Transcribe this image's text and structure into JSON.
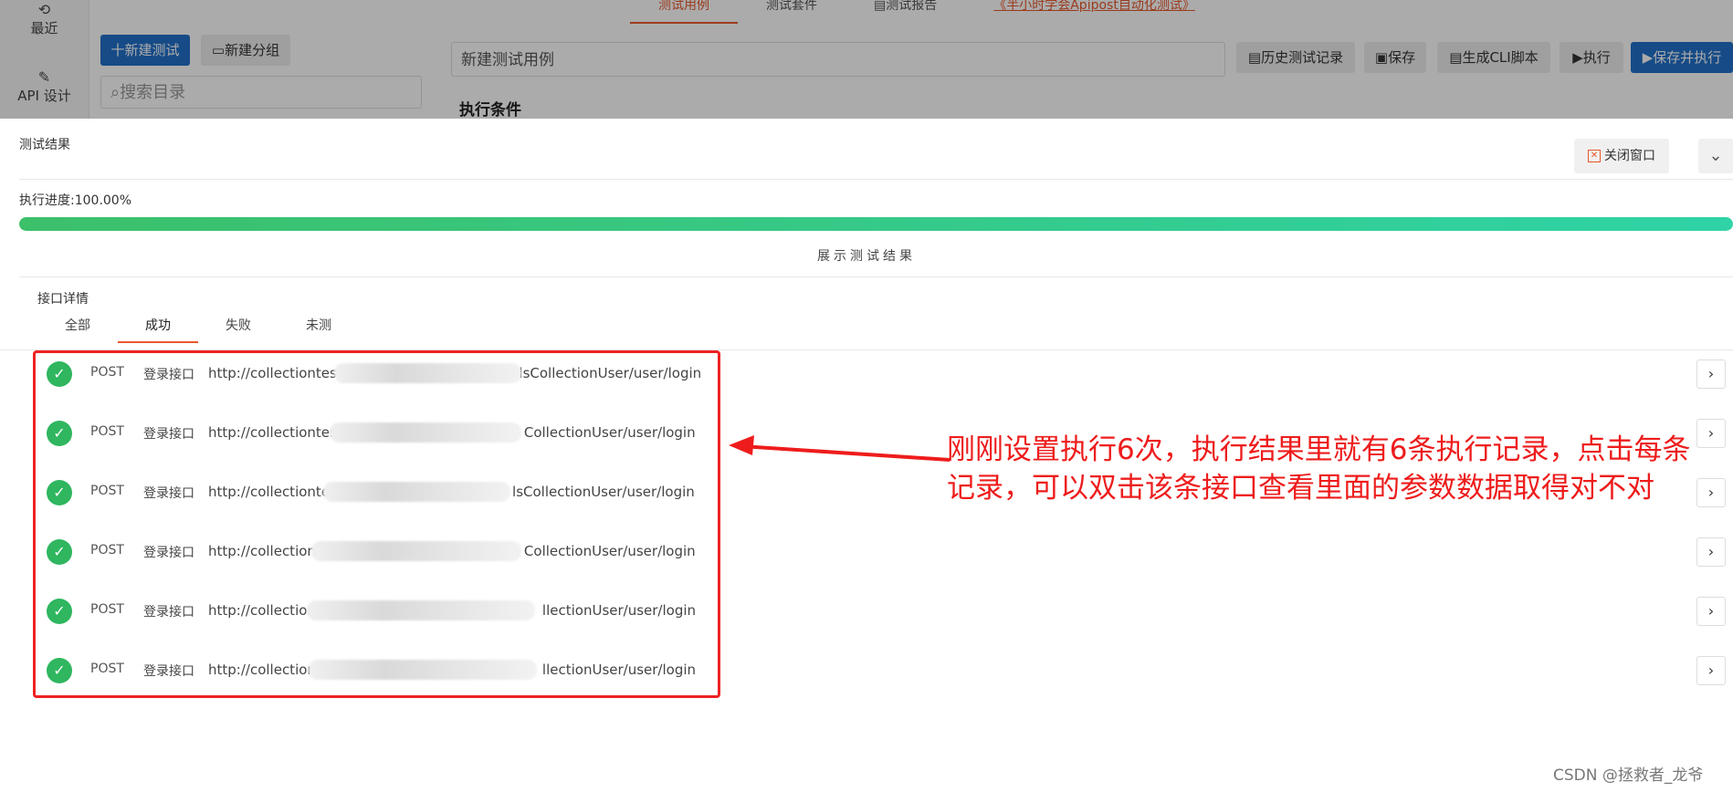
{
  "leftnav": {
    "items": [
      {
        "label": "最近",
        "icon": "history-icon"
      },
      {
        "label": "API 设计",
        "icon": "edit-icon"
      }
    ]
  },
  "topnav": {
    "tabs": [
      "测试用例",
      "测试套件",
      "测试报告"
    ],
    "link": "《半小时学会Apipost自动化测试》"
  },
  "sidebar": {
    "new_test": "十新建测试",
    "new_group": "新建分组",
    "search_placeholder": "搜索目录"
  },
  "toolbar": {
    "case_name": "新建测试用例",
    "history": "历史测试记录",
    "save": "保存",
    "gen_cli": "生成CLI脚本",
    "run": "执行",
    "save_run": "保存并执行"
  },
  "conditions_title": "执行条件",
  "results": {
    "title": "测试结果",
    "close": "关闭窗口",
    "progress_label": "执行进度:100.00%",
    "progress_value": 100,
    "show_results": "展示测试结果",
    "detail_title": "接口详情",
    "tabs": [
      "全部",
      "成功",
      "失败",
      "未测"
    ],
    "active_tab": 1,
    "rows": [
      {
        "method": "POST",
        "name": "登录接口",
        "url_start": "http://collectiontest",
        "url_end": "113/lsCollectionUser/user/login"
      },
      {
        "method": "POST",
        "name": "登录接口",
        "url_start": "http://collectiontes",
        "url_end": "CollectionUser/user/login"
      },
      {
        "method": "POST",
        "name": "登录接口",
        "url_start": "http://collectionte",
        "url_end": "lsCollectionUser/user/login"
      },
      {
        "method": "POST",
        "name": "登录接口",
        "url_start": "http://collection",
        "url_end": "CollectionUser/user/login"
      },
      {
        "method": "POST",
        "name": "登录接口",
        "url_start": "http://collection",
        "url_end": "llectionUser/user/login"
      },
      {
        "method": "POST",
        "name": "登录接口",
        "url_start": "http://collection",
        "url_end": "llectionUser/user/login"
      }
    ]
  },
  "annotation": "刚刚设置执行6次，执行结果里就有6条执行记录，点击每条记录，可以双击该条接口查看里面的参数数据取得对不对",
  "watermark": "CSDN @拯救者_龙爷",
  "colors": {
    "primary": "#2271c9",
    "accent": "#e8582c",
    "success": "#2fb65f",
    "annotation": "#ee1c1c"
  }
}
